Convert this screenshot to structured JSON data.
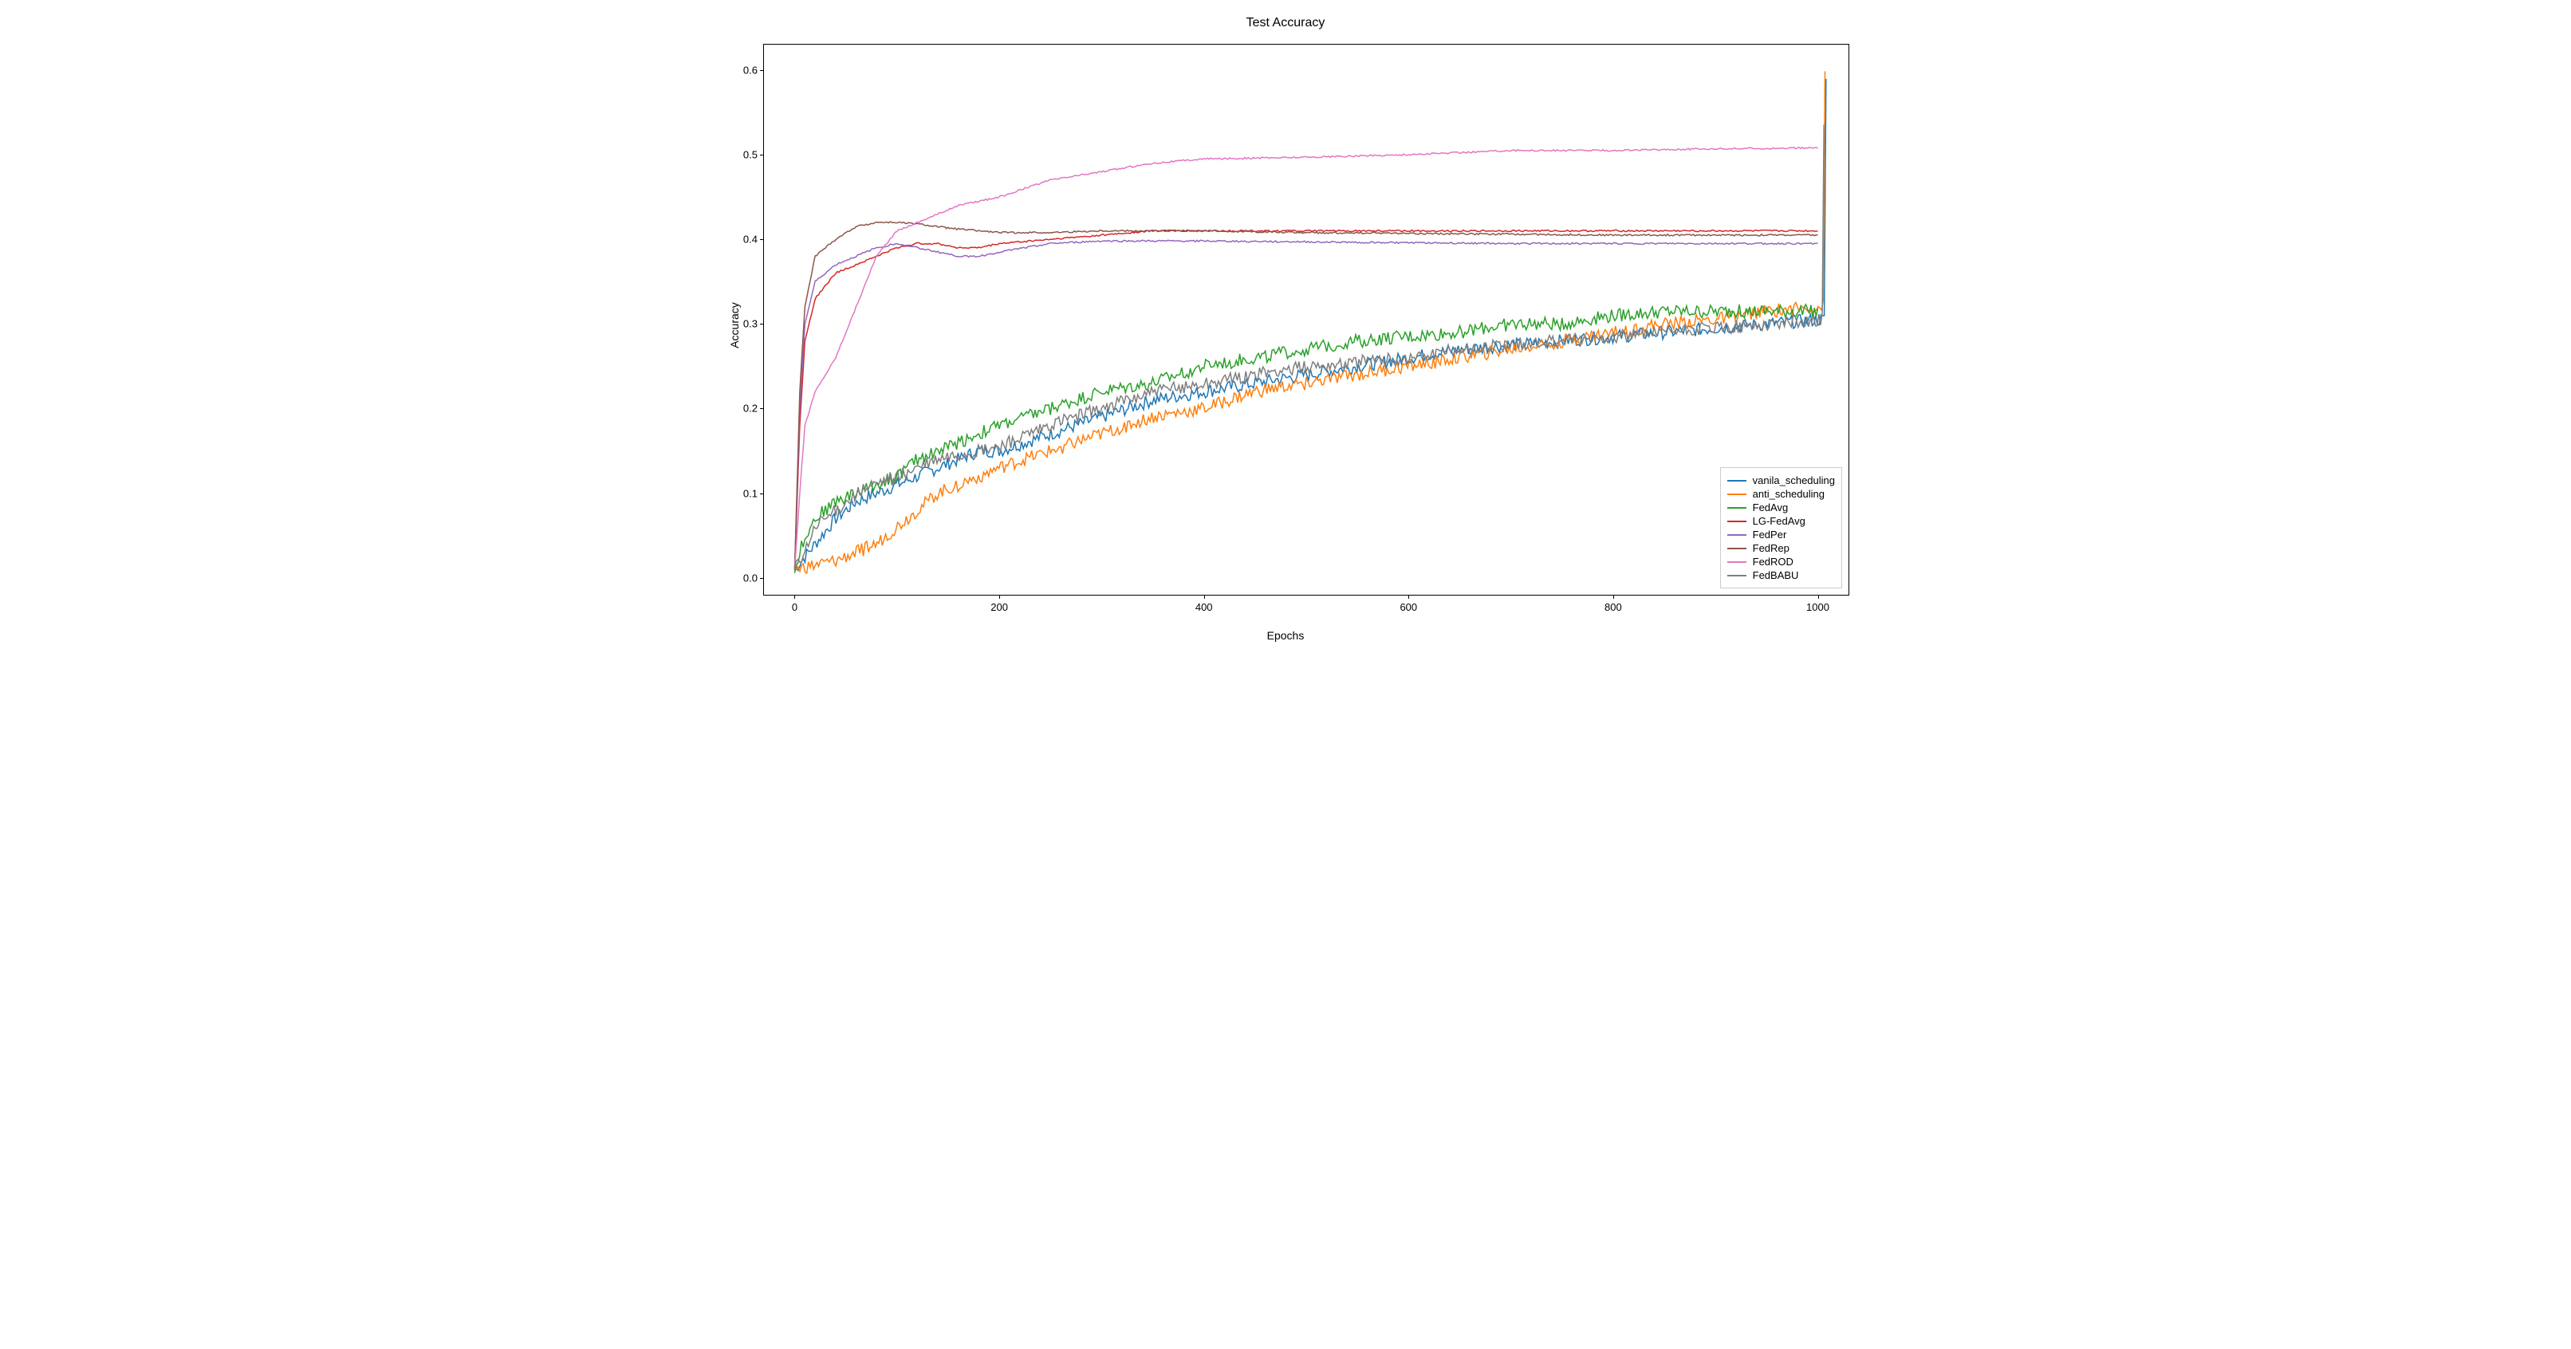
{
  "chart_data": {
    "type": "line",
    "title": "Test Accuracy",
    "xlabel": "Epochs",
    "ylabel": "Accuracy",
    "xlim": [
      -30,
      1030
    ],
    "ylim": [
      -0.02,
      0.63
    ],
    "xticks": [
      0,
      200,
      400,
      600,
      800,
      1000
    ],
    "yticks": [
      0.0,
      0.1,
      0.2,
      0.3,
      0.4,
      0.5,
      0.6
    ],
    "series": [
      {
        "name": "vanila_scheduling",
        "color": "#1f77b4",
        "x": [
          0,
          20,
          40,
          60,
          80,
          100,
          120,
          140,
          160,
          180,
          200,
          250,
          300,
          350,
          400,
          450,
          500,
          550,
          600,
          650,
          700,
          750,
          800,
          850,
          900,
          950,
          1000,
          1007,
          1008
        ],
        "values": [
          0.01,
          0.04,
          0.07,
          0.09,
          0.1,
          0.11,
          0.12,
          0.13,
          0.14,
          0.15,
          0.15,
          0.17,
          0.19,
          0.21,
          0.22,
          0.23,
          0.24,
          0.25,
          0.26,
          0.27,
          0.275,
          0.28,
          0.285,
          0.29,
          0.295,
          0.3,
          0.305,
          0.305,
          0.59
        ]
      },
      {
        "name": "anti_scheduling",
        "color": "#ff7f0e",
        "x": [
          0,
          20,
          40,
          60,
          80,
          100,
          120,
          140,
          160,
          180,
          200,
          250,
          300,
          350,
          400,
          450,
          500,
          550,
          600,
          650,
          700,
          750,
          800,
          850,
          900,
          950,
          1000,
          1006,
          1007
        ],
        "values": [
          0.01,
          0.015,
          0.02,
          0.03,
          0.04,
          0.06,
          0.08,
          0.1,
          0.11,
          0.12,
          0.13,
          0.15,
          0.17,
          0.19,
          0.2,
          0.22,
          0.23,
          0.24,
          0.25,
          0.26,
          0.27,
          0.28,
          0.29,
          0.3,
          0.305,
          0.315,
          0.32,
          0.32,
          0.605
        ]
      },
      {
        "name": "FedAvg",
        "color": "#2ca02c",
        "x": [
          0,
          10,
          20,
          40,
          60,
          80,
          100,
          120,
          140,
          160,
          180,
          200,
          250,
          300,
          350,
          400,
          450,
          500,
          550,
          600,
          650,
          700,
          750,
          800,
          850,
          900,
          950,
          1000
        ],
        "values": [
          0.01,
          0.05,
          0.07,
          0.09,
          0.1,
          0.11,
          0.12,
          0.14,
          0.15,
          0.16,
          0.17,
          0.18,
          0.2,
          0.22,
          0.23,
          0.25,
          0.26,
          0.27,
          0.28,
          0.285,
          0.29,
          0.3,
          0.3,
          0.31,
          0.315,
          0.315,
          0.315,
          0.315
        ]
      },
      {
        "name": "LG-FedAvg",
        "color": "#d62728",
        "x": [
          0,
          5,
          10,
          20,
          40,
          60,
          80,
          100,
          120,
          140,
          160,
          180,
          200,
          250,
          300,
          350,
          400,
          500,
          600,
          700,
          800,
          900,
          1000
        ],
        "values": [
          0.01,
          0.18,
          0.28,
          0.33,
          0.36,
          0.37,
          0.38,
          0.39,
          0.395,
          0.395,
          0.39,
          0.39,
          0.395,
          0.4,
          0.405,
          0.41,
          0.41,
          0.41,
          0.41,
          0.41,
          0.41,
          0.41,
          0.41
        ]
      },
      {
        "name": "FedPer",
        "color": "#9467bd",
        "x": [
          0,
          5,
          10,
          20,
          40,
          60,
          80,
          100,
          120,
          140,
          160,
          180,
          200,
          250,
          300,
          350,
          400,
          500,
          600,
          700,
          800,
          900,
          1000
        ],
        "values": [
          0.01,
          0.2,
          0.3,
          0.35,
          0.37,
          0.38,
          0.39,
          0.395,
          0.39,
          0.385,
          0.38,
          0.38,
          0.385,
          0.395,
          0.398,
          0.398,
          0.398,
          0.397,
          0.396,
          0.395,
          0.395,
          0.395,
          0.395
        ]
      },
      {
        "name": "FedRep",
        "color": "#8c564b",
        "x": [
          0,
          5,
          10,
          20,
          40,
          60,
          80,
          100,
          120,
          140,
          160,
          180,
          200,
          250,
          300,
          350,
          400,
          500,
          600,
          700,
          800,
          900,
          1000
        ],
        "values": [
          0.01,
          0.22,
          0.32,
          0.38,
          0.4,
          0.415,
          0.42,
          0.42,
          0.418,
          0.415,
          0.412,
          0.41,
          0.408,
          0.408,
          0.41,
          0.41,
          0.41,
          0.408,
          0.407,
          0.406,
          0.405,
          0.405,
          0.405
        ]
      },
      {
        "name": "FedROD",
        "color": "#e377c2",
        "x": [
          0,
          5,
          10,
          20,
          40,
          60,
          80,
          100,
          120,
          140,
          160,
          180,
          200,
          250,
          300,
          350,
          400,
          500,
          600,
          700,
          800,
          900,
          1000
        ],
        "values": [
          0.01,
          0.1,
          0.18,
          0.22,
          0.26,
          0.32,
          0.38,
          0.41,
          0.42,
          0.43,
          0.44,
          0.445,
          0.45,
          0.47,
          0.48,
          0.49,
          0.495,
          0.497,
          0.5,
          0.505,
          0.505,
          0.507,
          0.508
        ]
      },
      {
        "name": "FedBABU",
        "color": "#7f7f7f",
        "x": [
          0,
          10,
          20,
          40,
          60,
          80,
          100,
          120,
          140,
          160,
          180,
          200,
          250,
          300,
          350,
          400,
          450,
          500,
          550,
          600,
          650,
          700,
          750,
          800,
          850,
          900,
          950,
          1000,
          1005,
          1006
        ],
        "values": [
          0.01,
          0.03,
          0.06,
          0.08,
          0.1,
          0.11,
          0.12,
          0.13,
          0.14,
          0.145,
          0.15,
          0.155,
          0.18,
          0.2,
          0.22,
          0.23,
          0.24,
          0.25,
          0.255,
          0.26,
          0.27,
          0.275,
          0.28,
          0.285,
          0.29,
          0.295,
          0.3,
          0.305,
          0.305,
          0.53
        ]
      }
    ]
  }
}
